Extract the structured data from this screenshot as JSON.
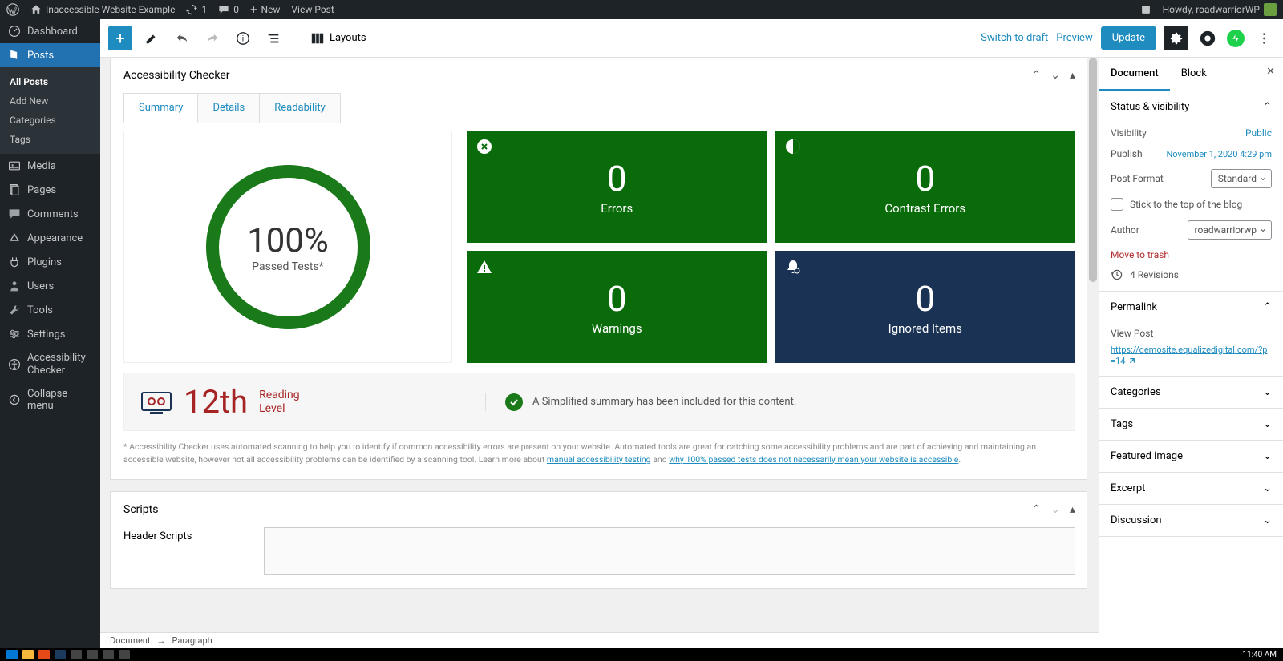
{
  "adminbar": {
    "site_title": "Inaccessible Website Example",
    "updates_count": "1",
    "comments_count": "0",
    "new_label": "New",
    "view_post": "View Post",
    "howdy": "Howdy, roadwarriorWP"
  },
  "sidebar": {
    "dashboard": "Dashboard",
    "posts": "Posts",
    "sub": {
      "all": "All Posts",
      "add": "Add New",
      "cat": "Categories",
      "tags": "Tags"
    },
    "media": "Media",
    "pages": "Pages",
    "comments": "Comments",
    "appearance": "Appearance",
    "plugins": "Plugins",
    "users": "Users",
    "tools": "Tools",
    "settings": "Settings",
    "acc": "Accessibility Checker",
    "collapse": "Collapse menu"
  },
  "toolbar": {
    "layouts": "Layouts",
    "switch_draft": "Switch to draft",
    "preview": "Preview",
    "update": "Update"
  },
  "acc_panel": {
    "title": "Accessibility Checker",
    "tabs": {
      "summary": "Summary",
      "details": "Details",
      "readability": "Readability"
    },
    "gauge_pct": "100%",
    "gauge_lbl": "Passed Tests*",
    "cards": {
      "errors": {
        "num": "0",
        "lbl": "Errors"
      },
      "contrast": {
        "num": "0",
        "lbl": "Contrast Errors"
      },
      "warnings": {
        "num": "0",
        "lbl": "Warnings"
      },
      "ignored": {
        "num": "0",
        "lbl": "Ignored Items"
      }
    },
    "reading_grade": "12th",
    "reading_lbl1": "Reading",
    "reading_lbl2": "Level",
    "summary_msg": "A Simplified summary has been included for this content.",
    "disclaimer_pre": "* Accessibility Checker uses automated scanning to help you to identify if common accessibility errors are present on your website. Automated tools are great for catching some accessibility problems and are part of achieving and maintaining an accessible website, however not all accessibility problems can be identified by a scanning tool. Learn more about ",
    "disclaimer_link1": "manual accessibility testing",
    "disclaimer_mid": " and ",
    "disclaimer_link2": "why 100% passed tests does not necessarily mean your website is accessible",
    "disclaimer_end": "."
  },
  "scripts_panel": {
    "title": "Scripts",
    "header_scripts": "Header Scripts"
  },
  "inspector": {
    "tabs": {
      "document": "Document",
      "block": "Block"
    },
    "status": {
      "title": "Status & visibility",
      "visibility_lbl": "Visibility",
      "visibility_val": "Public",
      "publish_lbl": "Publish",
      "publish_val": "November 1, 2020 4:29 pm",
      "format_lbl": "Post Format",
      "format_val": "Standard",
      "stick": "Stick to the top of the blog",
      "author_lbl": "Author",
      "author_val": "roadwarriorwp",
      "trash": "Move to trash",
      "revisions": "4 Revisions"
    },
    "permalink": {
      "title": "Permalink",
      "view_post": "View Post",
      "url": "https://demosite.equalizedigital.com/?p=14"
    },
    "categories": "Categories",
    "tags": "Tags",
    "featured": "Featured image",
    "excerpt": "Excerpt",
    "discussion": "Discussion"
  },
  "breadcrumb": {
    "doc": "Document",
    "para": "Paragraph"
  },
  "taskbar": {
    "time": "11:40 AM"
  }
}
